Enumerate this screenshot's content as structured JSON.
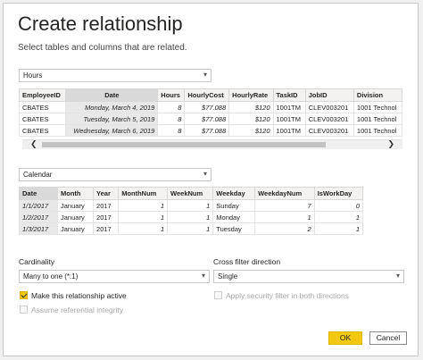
{
  "dialog": {
    "title": "Create relationship",
    "subtitle": "Select tables and columns that are related."
  },
  "table1": {
    "selected": "Hours",
    "headers": [
      "EmployeeID",
      "Date",
      "Hours",
      "HourlyCost",
      "HourlyRate",
      "TaskID",
      "JobID",
      "Division"
    ],
    "rows": [
      [
        "CBATES",
        "Monday, March 4, 2019",
        "8",
        "$77.088",
        "$120",
        "1001TM",
        "CLEV003201",
        "1001 Technol"
      ],
      [
        "CBATES",
        "Tuesday, March 5, 2019",
        "8",
        "$77.088",
        "$120",
        "1001TM",
        "CLEV003201",
        "1001 Technol"
      ],
      [
        "CBATES",
        "Wednesday, March 6, 2019",
        "8",
        "$77.088",
        "$120",
        "1001TM",
        "CLEV003201",
        "1001 Technol"
      ]
    ]
  },
  "table2": {
    "selected": "Calendar",
    "headers": [
      "Date",
      "Month",
      "Year",
      "MonthNum",
      "WeekNum",
      "Weekday",
      "WeekdayNum",
      "IsWorkDay"
    ],
    "rows": [
      [
        "1/1/2017",
        "January",
        "2017",
        "1",
        "1",
        "Sunday",
        "7",
        "0"
      ],
      [
        "1/2/2017",
        "January",
        "2017",
        "1",
        "1",
        "Monday",
        "1",
        "1"
      ],
      [
        "1/3/2017",
        "January",
        "2017",
        "1",
        "1",
        "Tuesday",
        "2",
        "1"
      ]
    ]
  },
  "cardinality": {
    "label": "Cardinality",
    "value": "Many to one (*:1)"
  },
  "cross_filter": {
    "label": "Cross filter direction",
    "value": "Single"
  },
  "options": {
    "active": "Make this relationship active",
    "security": "Apply security filter in both directions",
    "integrity": "Assume referential integrity"
  },
  "buttons": {
    "ok": "OK",
    "cancel": "Cancel"
  },
  "colors": {
    "accent": "#f2c811"
  }
}
